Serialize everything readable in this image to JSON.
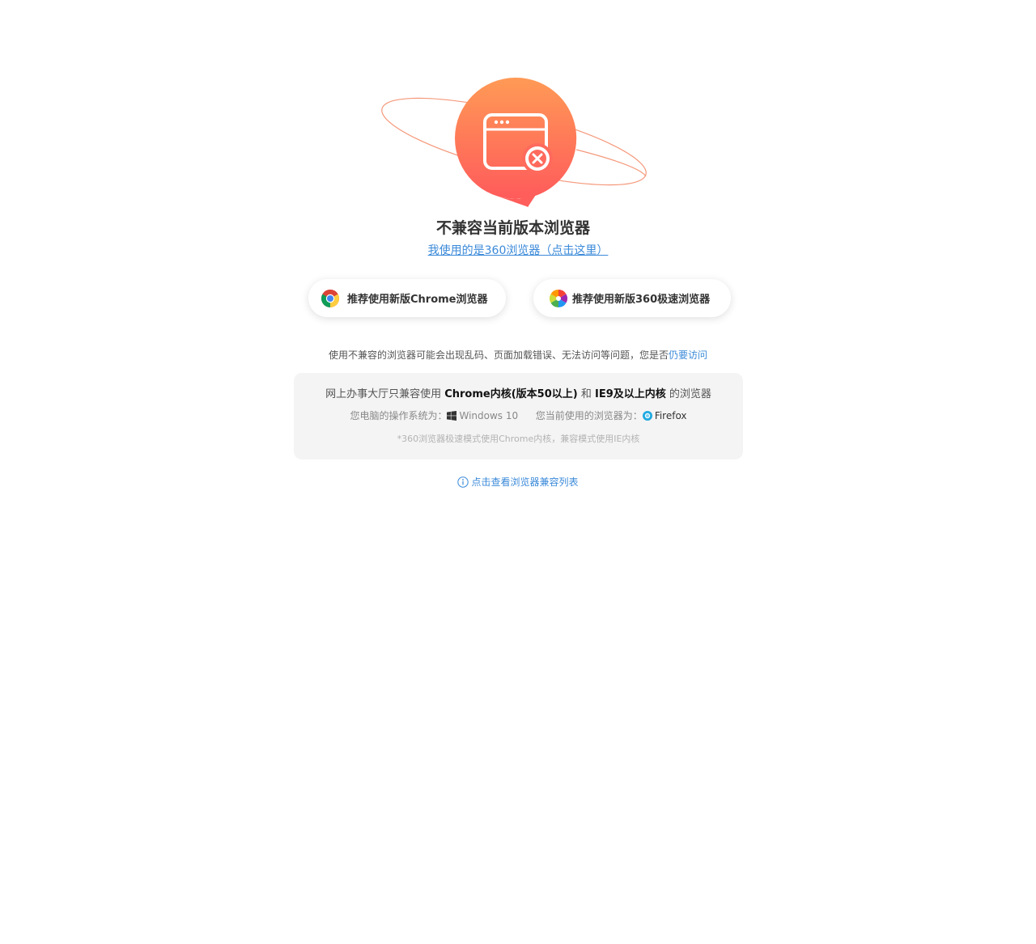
{
  "hero": {
    "illustration_icon": "browser-window-error-icon",
    "orbit_color": "#f5987a",
    "badge_gradient": [
      "#ff9a56",
      "#ff5b5b"
    ]
  },
  "title": "不兼容当前版本浏览器",
  "link_360": "我使用的是360浏览器（点击这里）",
  "buttons": {
    "chrome": {
      "label": "推荐使用新版Chrome浏览器",
      "icon": "chrome-logo-icon"
    },
    "se360": {
      "label": "推荐使用新版360极速浏览器",
      "icon": "360-browser-logo-icon"
    }
  },
  "warning": {
    "text": "使用不兼容的浏览器可能会出现乱码、页面加载错误、无法访问等问题，您是否",
    "continue_link": "仍要访问"
  },
  "panel": {
    "compat_prefix": "网上办事大厅只兼容使用",
    "compat_chrome": "Chrome内核(版本50以上)",
    "compat_and": "和",
    "compat_ie": "IE9及以上内核",
    "compat_suffix": "的浏览器",
    "os_label": "您电脑的操作系统为：",
    "os_value": "Windows 10",
    "os_icon": "windows-logo-icon",
    "browser_label": "您当前使用的浏览器为：",
    "browser_value": "Firefox",
    "browser_icon": "firefox-dot-icon",
    "note": "*360浏览器极速模式使用Chrome内核，兼容模式使用IE内核"
  },
  "compat_list_link": "点击查看浏览器兼容列表",
  "colors": {
    "link": "#3b8ad9",
    "panel_bg": "#f4f4f4"
  }
}
